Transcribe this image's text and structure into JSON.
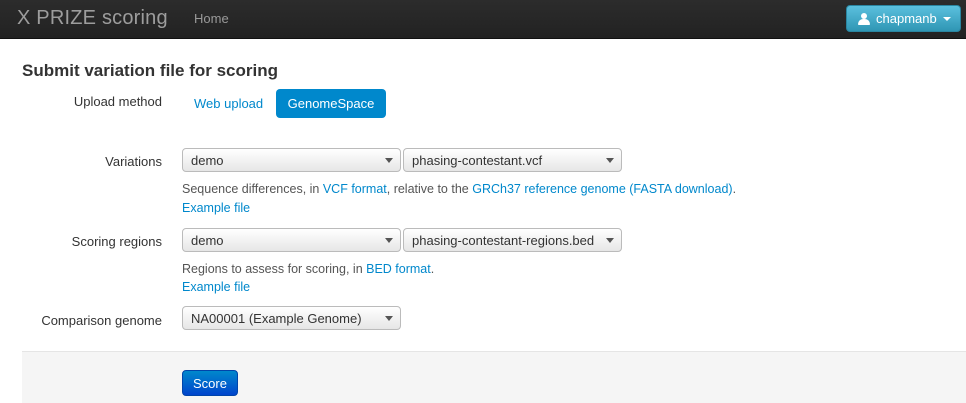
{
  "navbar": {
    "brand": "X PRIZE scoring",
    "home_label": "Home",
    "user_label": "chapmanb"
  },
  "page": {
    "title": "Submit variation file for scoring"
  },
  "upload": {
    "label": "Upload method",
    "options": [
      "Web upload",
      "GenomeSpace"
    ],
    "active": "GenomeSpace"
  },
  "variations": {
    "label": "Variations",
    "folder_select": "demo",
    "file_select": "phasing-contestant.vcf",
    "help_prefix": "Sequence differences, in ",
    "help_link1": "VCF format",
    "help_middle": ", relative to the ",
    "help_link2": "GRCh37 reference genome",
    "help_space": " ",
    "help_link3": "(FASTA download)",
    "help_suffix": ".",
    "example_link": "Example file"
  },
  "regions": {
    "label": "Scoring regions",
    "folder_select": "demo",
    "file_select": "phasing-contestant-regions.bed",
    "help_prefix": "Regions to assess for scoring, in ",
    "help_link": "BED format",
    "help_suffix": ".",
    "example_link": "Example file"
  },
  "comparison": {
    "label": "Comparison genome",
    "select": "NA00001 (Example Genome)"
  },
  "actions": {
    "score_label": "Score"
  },
  "colors": {
    "link": "#0088cc",
    "primary": "#0088cc",
    "navbar": "#222222",
    "user_button": "#49afcd"
  }
}
